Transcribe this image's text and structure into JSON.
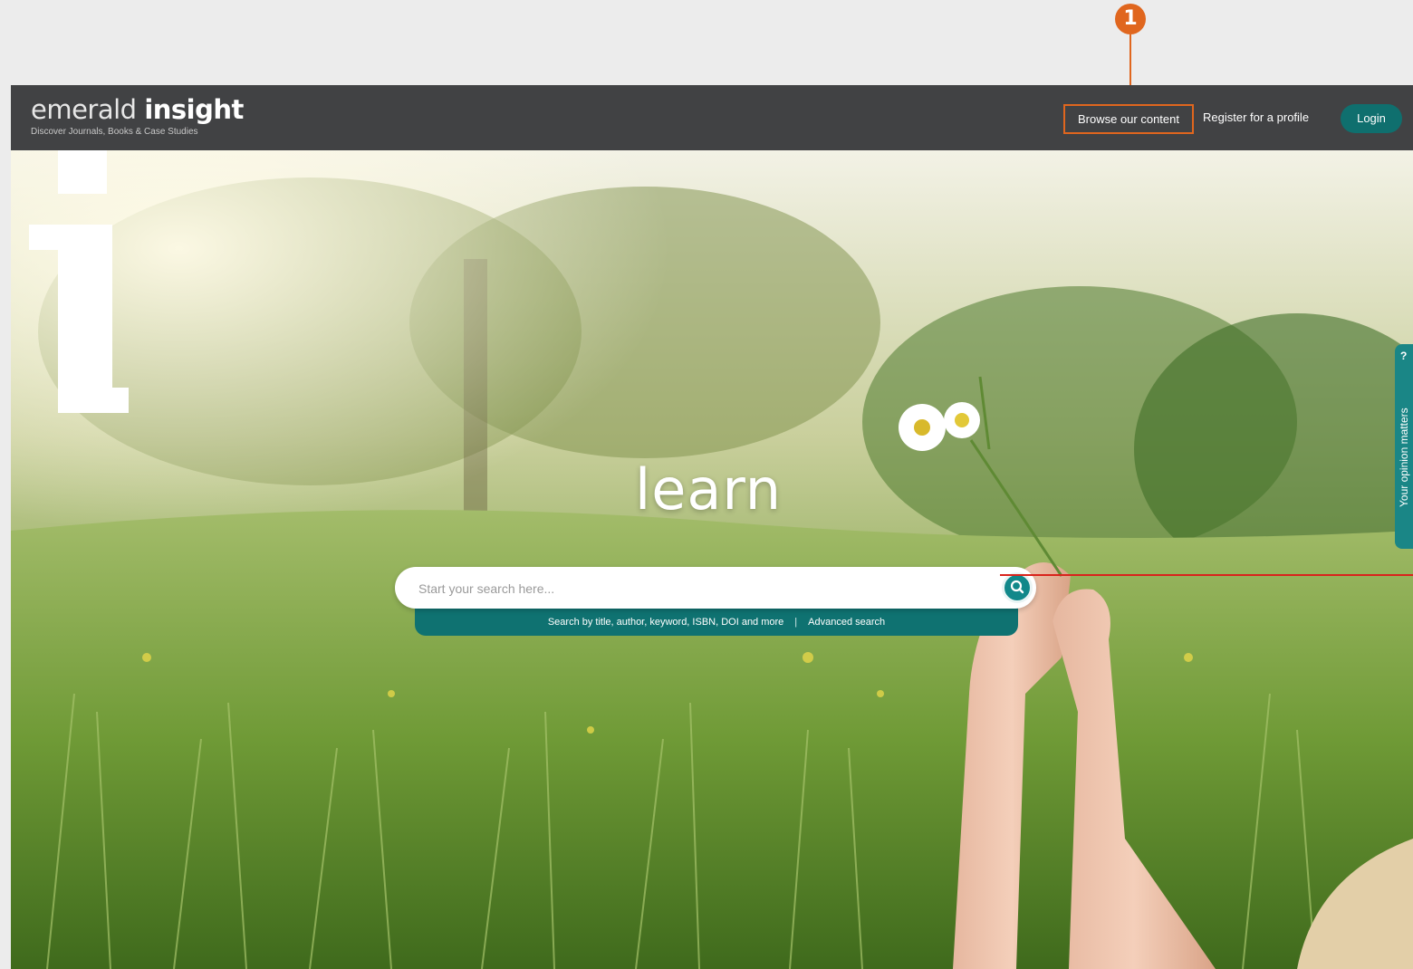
{
  "header": {
    "logo_light": "emerald ",
    "logo_bold": "insight",
    "tagline": "Discover Journals, Books & Case Studies",
    "nav": {
      "browse": "Browse our content",
      "register": "Register for a profile",
      "login": "Login"
    }
  },
  "hero": {
    "headline": "learn"
  },
  "search": {
    "placeholder": "Start your search here...",
    "hint": "Search by title, author, keyword, ISBN, DOI and more",
    "separator": "|",
    "advanced": "Advanced search"
  },
  "feedback": {
    "label": "Your opinion matters",
    "icon": "?"
  },
  "annotation": {
    "number": "1"
  },
  "colors": {
    "accent_teal": "#0f7271",
    "header_bg": "#414244",
    "annotation_orange": "#e0661e",
    "annotation_red": "#d9231c"
  }
}
